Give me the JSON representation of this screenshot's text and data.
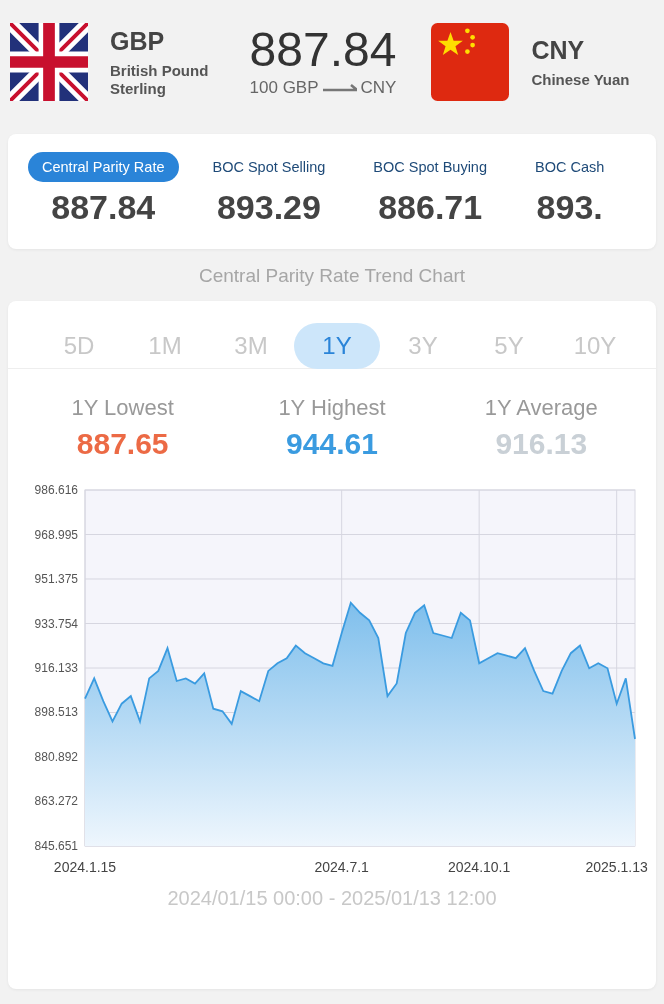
{
  "from": {
    "code": "GBP",
    "name": "British Pound Sterling"
  },
  "conversion": {
    "rate": "887.84",
    "base": "100 GBP",
    "target": "CNY"
  },
  "to": {
    "code": "CNY",
    "name": "Chinese Yuan"
  },
  "rate_types": [
    {
      "label": "Central Parity Rate",
      "value": "887.84",
      "selected": true
    },
    {
      "label": "BOC Spot Selling",
      "value": "893.29",
      "selected": false
    },
    {
      "label": "BOC Spot Buying",
      "value": "886.71",
      "selected": false
    },
    {
      "label": "BOC Cash",
      "value": "893.",
      "selected": false
    }
  ],
  "chart_title": "Central Parity Rate Trend Chart",
  "periods": [
    {
      "label": "5D",
      "selected": false
    },
    {
      "label": "1M",
      "selected": false
    },
    {
      "label": "3M",
      "selected": false
    },
    {
      "label": "1Y",
      "selected": true
    },
    {
      "label": "3Y",
      "selected": false
    },
    {
      "label": "5Y",
      "selected": false
    },
    {
      "label": "10Y",
      "selected": false
    }
  ],
  "stats": [
    {
      "label": "1Y Lowest",
      "value": "887.65",
      "color": "#ec6a45"
    },
    {
      "label": "1Y Highest",
      "value": "944.61",
      "color": "#3a9be0"
    },
    {
      "label": "1Y Average",
      "value": "916.13",
      "color": "#c9d0d6"
    }
  ],
  "chart_data": {
    "type": "area",
    "categories": [
      "2024.1.15",
      null,
      null,
      null,
      null,
      null,
      null,
      null,
      null,
      null,
      null,
      null,
      null,
      null,
      null,
      null,
      null,
      null,
      null,
      null,
      null,
      null,
      null,
      null,
      null,
      null,
      null,
      null,
      "2024.7.1",
      null,
      null,
      null,
      null,
      null,
      null,
      null,
      null,
      null,
      null,
      null,
      null,
      null,
      null,
      "2024.10.1",
      null,
      null,
      null,
      null,
      null,
      null,
      null,
      null,
      null,
      null,
      null,
      null,
      null,
      null,
      "2025.1.13",
      null,
      null
    ],
    "series": [
      {
        "color": "#3a9be0",
        "values": [
          904,
          912,
          903,
          895,
          902,
          905,
          895,
          912,
          915,
          924,
          911,
          912,
          910,
          914,
          900,
          899,
          894,
          907,
          905,
          903,
          915,
          918,
          920,
          925,
          922,
          920,
          918,
          917,
          930,
          942,
          938,
          935,
          928,
          905,
          910,
          930,
          938,
          941,
          930,
          929,
          928,
          938,
          935,
          918,
          920,
          922,
          921,
          920,
          924,
          915,
          907,
          906,
          915,
          922,
          925,
          916,
          918,
          916,
          902,
          912,
          888
        ]
      }
    ],
    "ylim": [
      845.651,
      986.616
    ],
    "grid": true,
    "yticks": [
      986.616,
      968.995,
      951.375,
      933.754,
      916.133,
      898.513,
      880.892,
      863.272,
      845.651
    ]
  },
  "date_range": "2024/01/15 00:00 - 2025/01/13 12:00"
}
